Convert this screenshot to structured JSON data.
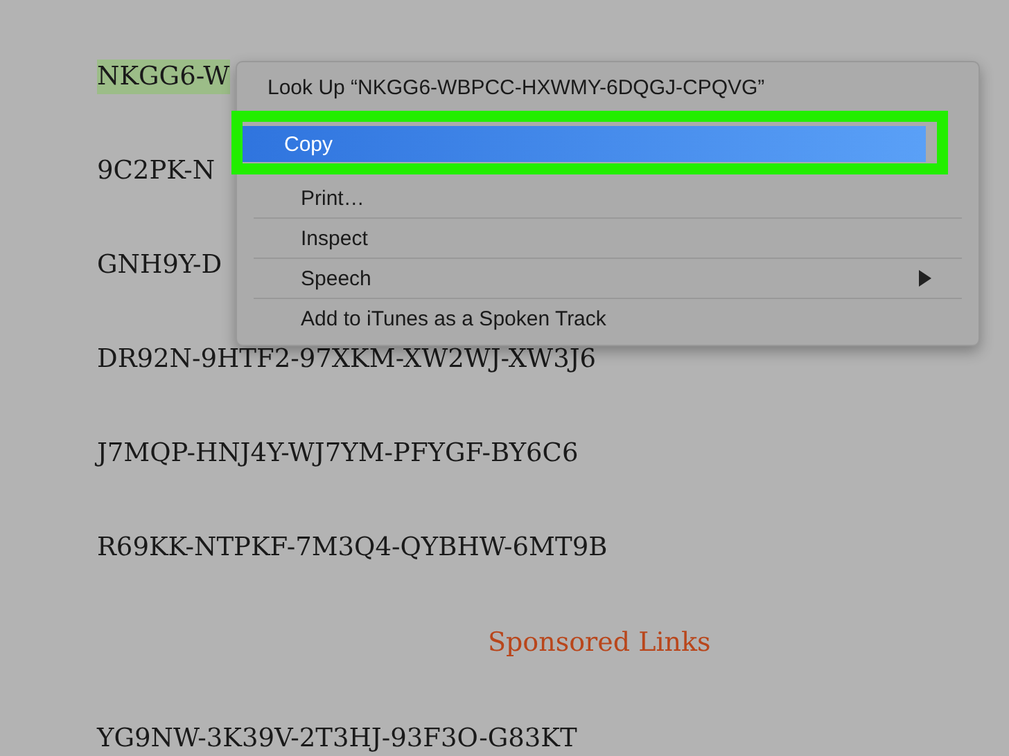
{
  "keys": [
    {
      "text": "NKGG6-W",
      "selected": true
    },
    {
      "text": "9C2PK-N",
      "selected": false
    },
    {
      "text": "GNH9Y-D",
      "selected": false
    },
    {
      "text": "DR92N-9HTF2-97XKM-XW2WJ-XW3J6",
      "selected": false
    },
    {
      "text": "J7MQP-HNJ4Y-WJ7YM-PFYGF-BY6C6",
      "selected": false
    },
    {
      "text": "R69KK-NTPKF-7M3Q4-QYBHW-6MT9B",
      "selected": false
    }
  ],
  "sponsored_heading": "Sponsored Links",
  "keys_after": [
    {
      "text": "YG9NW-3K39V-2T3HJ-93F3O-G83KT",
      "selected": false
    }
  ],
  "context_menu": {
    "items": [
      {
        "label": "Look Up “NKGG6-WBPCC-HXWMY-6DQGJ-CPQVG”",
        "selected": false,
        "submenu": false
      },
      {
        "label": "Copy",
        "selected": true,
        "submenu": false
      },
      {
        "label": "Print…",
        "selected": false,
        "submenu": false
      },
      {
        "label": "Inspect",
        "selected": false,
        "submenu": false
      },
      {
        "label": "Speech",
        "selected": false,
        "submenu": true
      },
      {
        "label": "Add to iTunes as a Spoken Track",
        "selected": false,
        "submenu": false
      }
    ],
    "highlight_frame": true
  }
}
